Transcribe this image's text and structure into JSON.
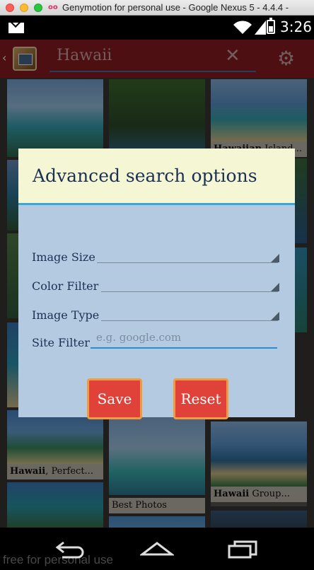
{
  "window": {
    "title": "Genymotion for personal use - Google Nexus 5 - 4.4.4 -"
  },
  "statusbar": {
    "time": "3:26",
    "icons": [
      "mail-icon",
      "wifi-icon",
      "signal-icon",
      "battery-icon"
    ]
  },
  "actionbar": {
    "query": "Hawaii",
    "clear_icon": "✕",
    "settings_icon": "⚙"
  },
  "grid": {
    "captions": [
      {
        "bold": "Hawaii",
        "rest": ", Perfect..."
      },
      {
        "bold": "Hawaii",
        "rest": " Group..."
      },
      {
        "bold": "",
        "rest": "Best Photos"
      },
      {
        "bold": "Hawaiian",
        "rest": " Island..."
      }
    ]
  },
  "dialog": {
    "title": "Advanced search options",
    "fields": {
      "image_size": "Image Size",
      "color_filter": "Color Filter",
      "image_type": "Image Type",
      "site_filter": "Site Filter"
    },
    "site_filter_placeholder": "e.g. google.com",
    "save_label": "Save",
    "reset_label": "Reset"
  },
  "watermark": "free for personal use",
  "colors": {
    "actionbar": "#8c1d1f",
    "dialog_header": "#f5f7d4",
    "dialog_body": "#b3cae0",
    "accent_line": "#39a9dc",
    "button": "#e0423a",
    "button_border": "#f19a40"
  }
}
